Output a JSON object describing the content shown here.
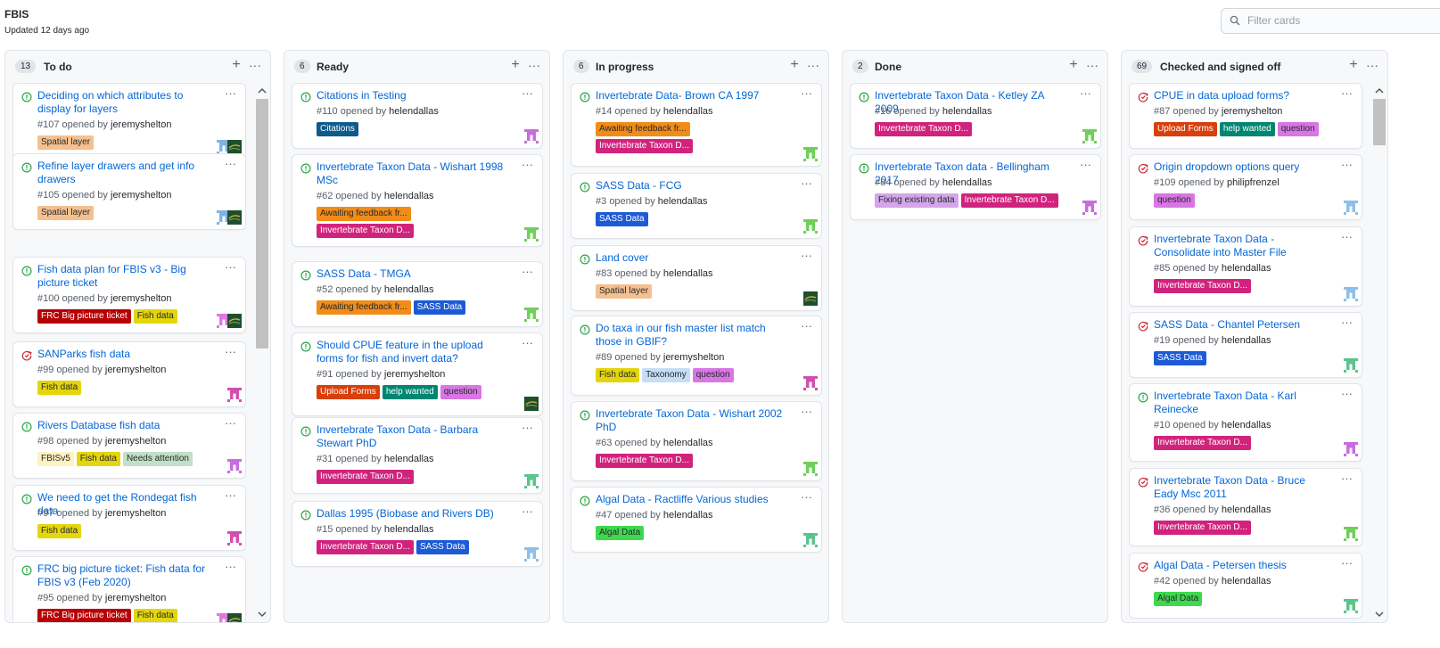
{
  "board": {
    "title": "FBIS",
    "updated": "Updated 12 days ago"
  },
  "filter": {
    "placeholder": "Filter cards"
  },
  "colors": {
    "link": "#0366d6",
    "open": "#28a745",
    "closed": "#cb2431"
  },
  "columns": [
    {
      "name": "To do",
      "count": "13",
      "cards": [
        {
          "title": "Deciding on which attributes to display for layers",
          "number": "#107",
          "opened_by": "opened by",
          "user": "jeremyshelton",
          "state": "open",
          "labels": [
            {
              "text": "Spatial layer",
              "bg": "#f5c08f",
              "fg": "#24292e"
            }
          ],
          "avatars": [
            "av-blue",
            "av-green"
          ]
        },
        {
          "title": "Refine layer drawers and get info drawers",
          "number": "#105",
          "opened_by": "opened by",
          "user": "jeremyshelton",
          "state": "open",
          "labels": [
            {
              "text": "Spatial layer",
              "bg": "#f5c08f",
              "fg": "#24292e"
            }
          ],
          "avatars": [
            "av-blue",
            "av-green"
          ]
        },
        {
          "title": "Fish data plan for FBIS v3 - Big picture ticket",
          "number": "#100",
          "opened_by": "opened by",
          "user": "jeremyshelton",
          "state": "open",
          "labels": [
            {
              "text": "FRC Big picture ticket",
              "bg": "#b60205",
              "fg": "#ffffff"
            },
            {
              "text": "Fish data",
              "bg": "#e4d50c",
              "fg": "#24292e"
            }
          ],
          "avatars": [
            "av-pink",
            "av-green"
          ]
        },
        {
          "title": "SANParks fish data",
          "number": "#99",
          "opened_by": "opened by",
          "user": "jeremyshelton",
          "state": "closed",
          "labels": [
            {
              "text": "Fish data",
              "bg": "#e4d50c",
              "fg": "#24292e"
            }
          ],
          "avatars": [
            "av-magenta"
          ]
        },
        {
          "title": "Rivers Database fish data",
          "number": "#98",
          "opened_by": "opened by",
          "user": "jeremyshelton",
          "state": "open",
          "labels": [
            {
              "text": "FBISv5",
              "bg": "#fef2c0",
              "fg": "#24292e"
            },
            {
              "text": "Fish data",
              "bg": "#e4d50c",
              "fg": "#24292e"
            },
            {
              "text": "Needs attention",
              "bg": "#c2e0c6",
              "fg": "#24292e"
            }
          ],
          "avatars": [
            "av-violet"
          ]
        },
        {
          "title": "We need to get the Rondegat fish data",
          "number": "#97",
          "opened_by": "opened by",
          "user": "jeremyshelton",
          "state": "open",
          "labels": [
            {
              "text": "Fish data",
              "bg": "#e4d50c",
              "fg": "#24292e"
            }
          ],
          "avatars": [
            "av-magenta"
          ]
        },
        {
          "title": "FRC big picture ticket: Fish data for FBIS v3 (Feb 2020)",
          "number": "#95",
          "opened_by": "opened by",
          "user": "jeremyshelton",
          "state": "open",
          "labels": [
            {
              "text": "FRC Big picture ticket",
              "bg": "#b60205",
              "fg": "#ffffff"
            },
            {
              "text": "Fish data",
              "bg": "#e4d50c",
              "fg": "#24292e"
            }
          ],
          "avatars": [
            "av-pink",
            "av-green"
          ]
        }
      ]
    },
    {
      "name": "Ready",
      "count": "6",
      "cards": [
        {
          "title": "Citations in Testing",
          "number": "#110",
          "opened_by": "opened by",
          "user": "helendallas",
          "state": "open",
          "labels": [
            {
              "text": "Citations",
              "bg": "#0e5a8a",
              "fg": "#ffffff"
            }
          ],
          "avatars": [
            "av-violet"
          ]
        },
        {
          "title": "Invertebrate Taxon Data - Wishart 1998 MSc",
          "number": "#62",
          "opened_by": "opened by",
          "user": "helendallas",
          "state": "open",
          "labels": [
            {
              "text": "Awaiting feedback fr...",
              "bg": "#f28c18",
              "fg": "#24292e"
            },
            {
              "text": "Invertebrate Taxon D...",
              "bg": "#d1237d",
              "fg": "#ffffff"
            }
          ],
          "avatars": [
            "av-lime"
          ]
        },
        {
          "title": "SASS Data - TMGA",
          "number": "#52",
          "opened_by": "opened by",
          "user": "helendallas",
          "state": "open",
          "labels": [
            {
              "text": "Awaiting feedback fr...",
              "bg": "#f28c18",
              "fg": "#24292e"
            },
            {
              "text": "SASS Data",
              "bg": "#1d5bd6",
              "fg": "#ffffff"
            }
          ],
          "avatars": [
            "av-lime"
          ]
        },
        {
          "title": "Should CPUE feature in the upload forms for fish and invert data?",
          "number": "#91",
          "opened_by": "opened by",
          "user": "jeremyshelton",
          "state": "open",
          "labels": [
            {
              "text": "Upload Forms",
              "bg": "#d93f0b",
              "fg": "#ffffff"
            },
            {
              "text": "help wanted",
              "bg": "#008672",
              "fg": "#ffffff"
            },
            {
              "text": "question",
              "bg": "#d876e3",
              "fg": "#24292e"
            }
          ],
          "avatars": [
            "av-green"
          ]
        },
        {
          "title": "Invertebrate Taxon Data - Barbara Stewart PhD",
          "number": "#31",
          "opened_by": "opened by",
          "user": "helendallas",
          "state": "open",
          "labels": [
            {
              "text": "Invertebrate Taxon D...",
              "bg": "#d1237d",
              "fg": "#ffffff"
            }
          ],
          "avatars": [
            "av-mint"
          ]
        },
        {
          "title": "Dallas 1995 (Biobase and Rivers DB)",
          "number": "#15",
          "opened_by": "opened by",
          "user": "helendallas",
          "state": "open",
          "labels": [
            {
              "text": "Invertebrate Taxon D...",
              "bg": "#d1237d",
              "fg": "#ffffff"
            },
            {
              "text": "SASS Data",
              "bg": "#1d5bd6",
              "fg": "#ffffff"
            }
          ],
          "avatars": [
            "av-sky"
          ]
        }
      ]
    },
    {
      "name": "In progress",
      "count": "6",
      "cards": [
        {
          "title": "Invertebrate Data- Brown CA 1997",
          "number": "#14",
          "opened_by": "opened by",
          "user": "helendallas",
          "state": "open",
          "labels": [
            {
              "text": "Awaiting feedback fr...",
              "bg": "#f28c18",
              "fg": "#24292e"
            },
            {
              "text": "Invertebrate Taxon D...",
              "bg": "#d1237d",
              "fg": "#ffffff"
            }
          ],
          "avatars": [
            "av-lime"
          ]
        },
        {
          "title": "SASS Data - FCG",
          "number": "#3",
          "opened_by": "opened by",
          "user": "helendallas",
          "state": "open",
          "labels": [
            {
              "text": "SASS Data",
              "bg": "#1d5bd6",
              "fg": "#ffffff"
            }
          ],
          "avatars": [
            "av-lime"
          ]
        },
        {
          "title": "Land cover",
          "number": "#83",
          "opened_by": "opened by",
          "user": "helendallas",
          "state": "open",
          "labels": [
            {
              "text": "Spatial layer",
              "bg": "#f5c08f",
              "fg": "#24292e"
            }
          ],
          "avatars": [
            "av-green"
          ]
        },
        {
          "title": "Do taxa in our fish master list match those in GBIF?",
          "number": "#89",
          "opened_by": "opened by",
          "user": "jeremyshelton",
          "state": "open",
          "labels": [
            {
              "text": "Fish data",
              "bg": "#e4d50c",
              "fg": "#24292e"
            },
            {
              "text": "Taxonomy",
              "bg": "#c5def5",
              "fg": "#24292e"
            },
            {
              "text": "question",
              "bg": "#d876e3",
              "fg": "#24292e"
            }
          ],
          "avatars": [
            "av-magenta"
          ]
        },
        {
          "title": "Invertebrate Taxon Data - Wishart 2002 PhD",
          "number": "#63",
          "opened_by": "opened by",
          "user": "helendallas",
          "state": "open",
          "labels": [
            {
              "text": "Invertebrate Taxon D...",
              "bg": "#d1237d",
              "fg": "#ffffff"
            }
          ],
          "avatars": [
            "av-lime"
          ]
        },
        {
          "title": "Algal Data - Ractliffe Various studies",
          "number": "#47",
          "opened_by": "opened by",
          "user": "helendallas",
          "state": "open",
          "labels": [
            {
              "text": "Algal Data",
              "bg": "#3ed94d",
              "fg": "#24292e"
            }
          ],
          "avatars": [
            "av-mint"
          ]
        }
      ]
    },
    {
      "name": "Done",
      "count": "2",
      "cards": [
        {
          "title": "Invertebrate Taxon Data - Ketley ZA 2009",
          "number": "#16",
          "opened_by": "opened by",
          "user": "helendallas",
          "state": "open",
          "labels": [
            {
              "text": "Invertebrate Taxon D...",
              "bg": "#d1237d",
              "fg": "#ffffff"
            }
          ],
          "avatars": [
            "av-lime"
          ]
        },
        {
          "title": "Invertebrate Taxon data - Bellingham 2017",
          "number": "#84",
          "opened_by": "opened by",
          "user": "helendallas",
          "state": "open",
          "labels": [
            {
              "text": "Fixing existing data",
              "bg": "#d4a5e8",
              "fg": "#24292e"
            },
            {
              "text": "Invertebrate Taxon D...",
              "bg": "#d1237d",
              "fg": "#ffffff"
            }
          ],
          "avatars": [
            "av-violet"
          ]
        }
      ]
    },
    {
      "name": "Checked and signed off",
      "count": "69",
      "cards": [
        {
          "title": "CPUE in data upload forms?",
          "number": "#87",
          "opened_by": "opened by",
          "user": "jeremyshelton",
          "state": "closed",
          "labels": [
            {
              "text": "Upload Forms",
              "bg": "#d93f0b",
              "fg": "#ffffff"
            },
            {
              "text": "help wanted",
              "bg": "#008672",
              "fg": "#ffffff"
            },
            {
              "text": "question",
              "bg": "#d876e3",
              "fg": "#24292e"
            }
          ],
          "avatars": []
        },
        {
          "title": "Origin dropdown options query",
          "number": "#109",
          "opened_by": "opened by",
          "user": "philipfrenzel",
          "state": "closed",
          "labels": [
            {
              "text": "question",
              "bg": "#d876e3",
              "fg": "#24292e"
            }
          ],
          "avatars": [
            "av-sky"
          ]
        },
        {
          "title": "Invertebrate Taxon Data - Consolidate into Master File",
          "number": "#85",
          "opened_by": "opened by",
          "user": "helendallas",
          "state": "closed",
          "labels": [
            {
              "text": "Invertebrate Taxon D...",
              "bg": "#d1237d",
              "fg": "#ffffff"
            }
          ],
          "avatars": [
            "av-sky"
          ]
        },
        {
          "title": "SASS Data - Chantel Petersen",
          "number": "#19",
          "opened_by": "opened by",
          "user": "helendallas",
          "state": "closed",
          "labels": [
            {
              "text": "SASS Data",
              "bg": "#1d5bd6",
              "fg": "#ffffff"
            }
          ],
          "avatars": [
            "av-mint"
          ]
        },
        {
          "title": "Invertebrate Taxon Data - Karl Reinecke",
          "number": "#10",
          "opened_by": "opened by",
          "user": "helendallas",
          "state": "open",
          "labels": [
            {
              "text": "Invertebrate Taxon D...",
              "bg": "#d1237d",
              "fg": "#ffffff"
            }
          ],
          "avatars": [
            "av-violet"
          ]
        },
        {
          "title": "Invertebrate Taxon Data - Bruce Eady Msc 2011",
          "number": "#36",
          "opened_by": "opened by",
          "user": "helendallas",
          "state": "closed",
          "labels": [
            {
              "text": "Invertebrate Taxon D...",
              "bg": "#d1237d",
              "fg": "#ffffff"
            }
          ],
          "avatars": [
            "av-lime"
          ]
        },
        {
          "title": "Algal Data - Petersen thesis",
          "number": "#42",
          "opened_by": "opened by",
          "user": "helendallas",
          "state": "closed",
          "labels": [
            {
              "text": "Algal Data",
              "bg": "#3ed94d",
              "fg": "#24292e"
            }
          ],
          "avatars": [
            "av-mint"
          ]
        }
      ]
    }
  ]
}
